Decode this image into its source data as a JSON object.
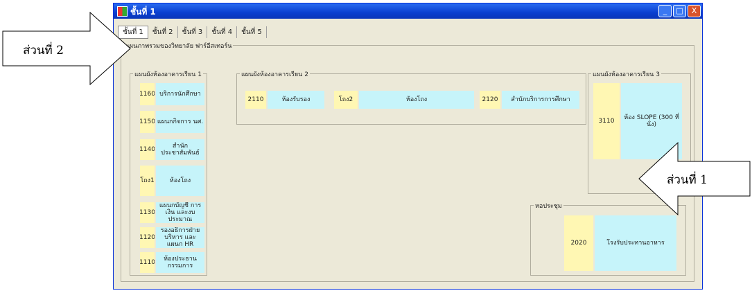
{
  "window": {
    "title": "ชั้นที่ 1",
    "buttons": [
      "_",
      "□",
      "X"
    ]
  },
  "tabs": [
    "ชั้นที่ 1",
    "ชั้นที่ 2",
    "ชั้นที่ 3",
    "ชั้นที่ 4",
    "ชั้นที่ 5"
  ],
  "panel_label": "แผนภาพรวมของวิทยาลัย ฟาร์อีสเทอร์น",
  "building1": {
    "label": "แผนผังห้องอาคารเรียน 1",
    "rooms": [
      {
        "num": "1160",
        "name": "บริการนักศึกษา"
      },
      {
        "num": "1150",
        "name": "แผนกกิจการ นศ."
      },
      {
        "num": "1140",
        "name": "สำนักประชาสัมพันธ์"
      },
      {
        "num": "โถง1",
        "name": "ห้องโถง"
      },
      {
        "num": "1130",
        "name": "แผนกบัญชี การเงิน และงบประมาณ"
      },
      {
        "num": "1120",
        "name": "รองอธิการฝ่ายบริหาร และ แผนก HR"
      },
      {
        "num": "1110",
        "name": "ห้องประธานกรรมการ"
      }
    ]
  },
  "building2": {
    "label": "แผนผังห้องอาคารเรียน 2",
    "rooms": [
      {
        "num": "2110",
        "name": "ห้องรับรอง"
      },
      {
        "num": "โถง2",
        "name": "ห้องโถง"
      },
      {
        "num": "2120",
        "name": "สำนักบริการการศึกษา"
      }
    ]
  },
  "building3": {
    "label": "แผนผังห้องอาคารเรียน 3",
    "room": {
      "num": "3110",
      "name": "ห้อง SLOPE (300 ที่นั่ง)"
    }
  },
  "hall": {
    "label": "หอประชุม",
    "room": {
      "num": "2020",
      "name": "โรงรับประทานอาหาร"
    }
  },
  "callouts": {
    "part2": "ส่วนที่ 2",
    "part1": "ส่วนที่ 1"
  }
}
